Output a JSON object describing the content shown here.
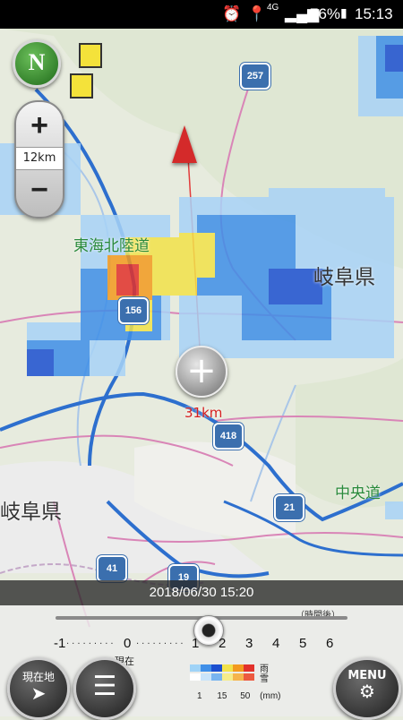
{
  "status_bar": {
    "network": "4G",
    "battery": "76%",
    "clock": "15:13"
  },
  "map": {
    "zoom_scale": "12km",
    "distance": "31km",
    "compass_letter": "N",
    "labels": {
      "expressway_tokai_hokuriku": "東海北陸道",
      "prefecture_gifu_east": "岐阜県",
      "prefecture_gifu_west": "岐阜県",
      "expressway_chuo": "中央道"
    },
    "routes": [
      "257",
      "156",
      "418",
      "21",
      "41",
      "19"
    ]
  },
  "timeline": {
    "datetime": "2018/06/30 15:20",
    "hours_after_label": "（時間後）",
    "ticks": [
      "-1",
      "0",
      "1",
      "2",
      "3",
      "4",
      "5",
      "6"
    ],
    "now_label": "現在",
    "position_hours": 0
  },
  "legend": {
    "rain_label": "雨",
    "snow_label": "雪",
    "scale_values": [
      "1",
      "15",
      "50"
    ],
    "unit": "(mm)",
    "rain_colors": [
      "#9fd3f7",
      "#3f8fe8",
      "#1b4fd0",
      "#f2e24a",
      "#f39a1f",
      "#e2312b"
    ],
    "snow_colors": [
      "#ffffff",
      "#c9e4fa",
      "#78b4f0",
      "#f5ec8a",
      "#f5b44d",
      "#ec5a40"
    ]
  },
  "buttons": {
    "current_location": "現在地",
    "menu": "MENU"
  }
}
